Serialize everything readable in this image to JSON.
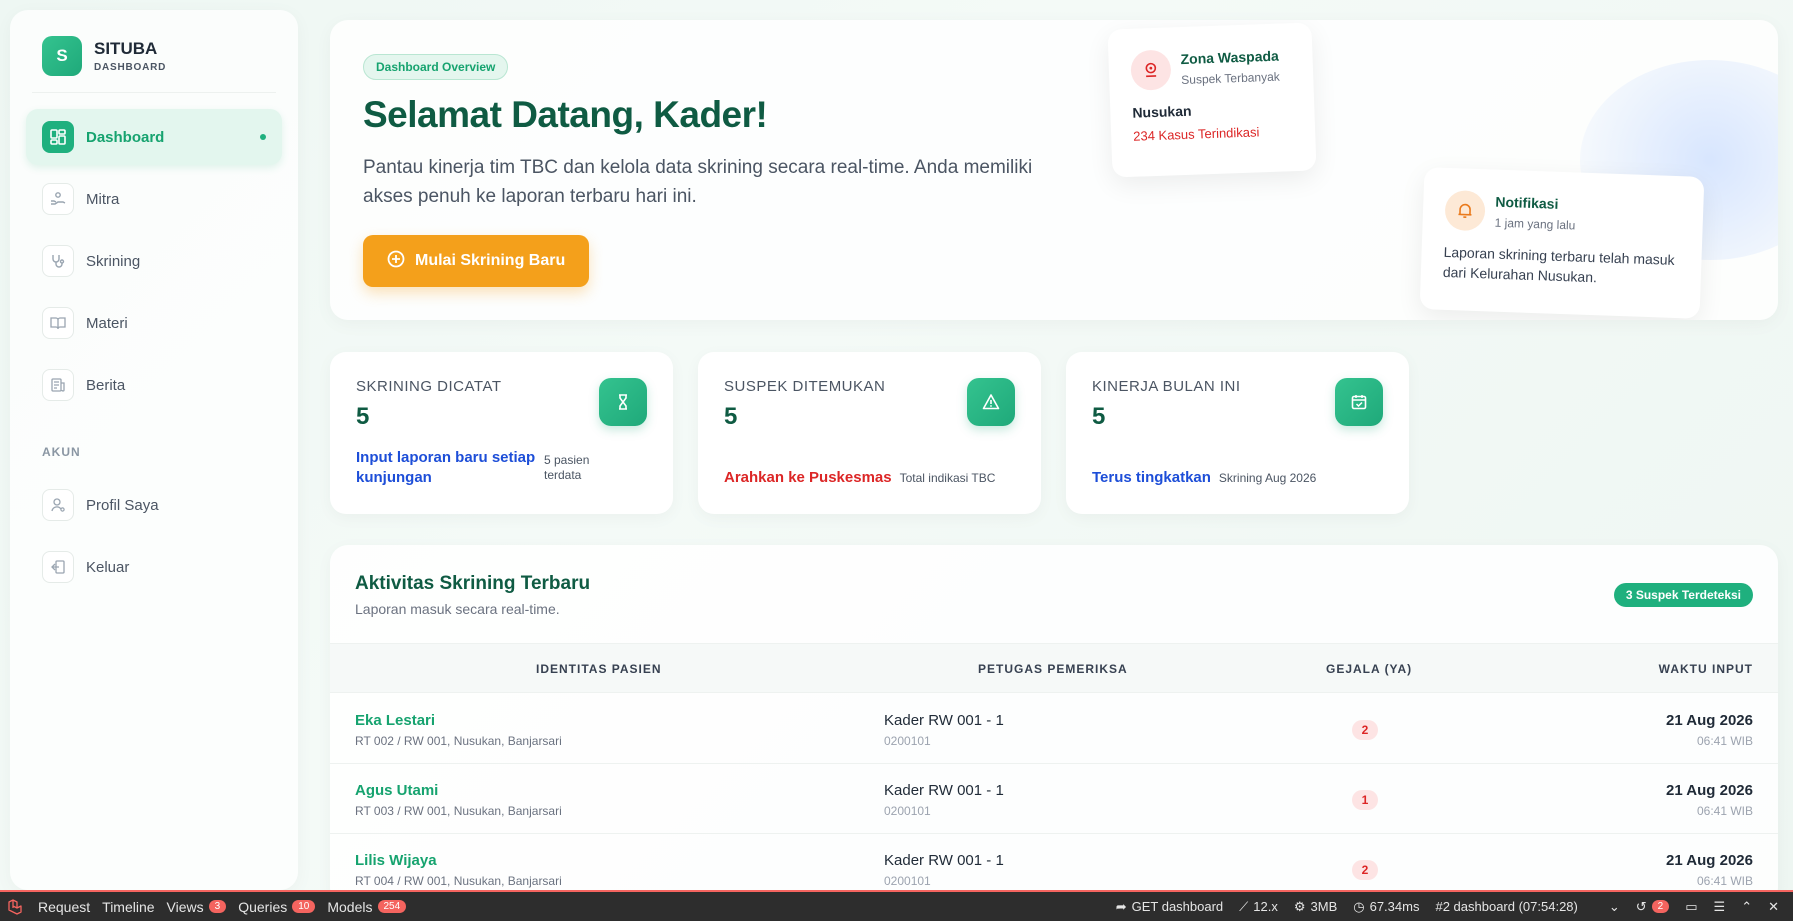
{
  "sidebar": {
    "brand_logo": "S",
    "brand_title": "SITUBA",
    "brand_subtitle": "DASHBOARD",
    "items": [
      {
        "label": "Dashboard",
        "icon": "dashboard-icon",
        "active": true
      },
      {
        "label": "Mitra",
        "icon": "handshake-icon"
      },
      {
        "label": "Skrining",
        "icon": "stethoscope-icon"
      },
      {
        "label": "Materi",
        "icon": "book-icon"
      },
      {
        "label": "Berita",
        "icon": "newspaper-icon"
      }
    ],
    "section_label": "AKUN",
    "account_items": [
      {
        "label": "Profil Saya",
        "icon": "user-icon"
      },
      {
        "label": "Keluar",
        "icon": "logout-icon"
      }
    ]
  },
  "hero": {
    "tag": "Dashboard Overview",
    "title": "Selamat Datang, Kader!",
    "description": "Pantau kinerja tim TBC dan kelola data skrining secara real-time. Anda memiliki akses penuh ke laporan terbaru hari ini.",
    "button_label": "Mulai Skrining Baru",
    "zona": {
      "title": "Zona Waspada",
      "subtitle": "Suspek Terbanyak",
      "place": "Nusukan",
      "count": "234 Kasus Terindikasi"
    },
    "notif": {
      "title": "Notifikasi",
      "time": "1 jam yang lalu",
      "text": "Laporan skrining terbaru telah masuk dari Kelurahan Nusukan."
    }
  },
  "stats": [
    {
      "label": "SKRINING DICATAT",
      "value": "5",
      "link": "Input laporan baru setiap kunjungan",
      "link_color": "#1d4ed8",
      "note": "5 pasien terdata",
      "icon": "hourglass-icon"
    },
    {
      "label": "SUSPEK DITEMUKAN",
      "value": "5",
      "link": "Arahkan ke Puskesmas",
      "link_color": "#dc2626",
      "note": "Total indikasi TBC",
      "icon": "warning-icon"
    },
    {
      "label": "KINERJA BULAN INI",
      "value": "5",
      "link": "Terus tingkatkan",
      "link_color": "#1d4ed8",
      "note": "Skrining Aug 2026",
      "icon": "calendar-check-icon"
    }
  ],
  "activity": {
    "title": "Aktivitas Skrining Terbaru",
    "subtitle": "Laporan masuk secara real-time.",
    "badge": "3 Suspek Terdeteksi",
    "columns": [
      "IDENTITAS PASIEN",
      "PETUGAS PEMERIKSA",
      "GEJALA (YA)",
      "WAKTU INPUT"
    ],
    "rows": [
      {
        "name": "Eka Lestari",
        "address": "RT 002 / RW 001, Nusukan, Banjarsari",
        "officer": "Kader RW 001 - 1",
        "code": "0200101",
        "gejala": "2",
        "date": "21 Aug 2026",
        "time": "06:41 WIB"
      },
      {
        "name": "Agus Utami",
        "address": "RT 003 / RW 001, Nusukan, Banjarsari",
        "officer": "Kader RW 001 - 1",
        "code": "0200101",
        "gejala": "1",
        "date": "21 Aug 2026",
        "time": "06:41 WIB"
      },
      {
        "name": "Lilis Wijaya",
        "address": "RT 004 / RW 001, Nusukan, Banjarsari",
        "officer": "Kader RW 001 - 1",
        "code": "0200101",
        "gejala": "2",
        "date": "21 Aug 2026",
        "time": "06:41 WIB"
      }
    ]
  },
  "debugbar": {
    "tabs": [
      {
        "label": "Request"
      },
      {
        "label": "Timeline"
      },
      {
        "label": "Views",
        "badge": "3"
      },
      {
        "label": "Queries",
        "badge": "10"
      },
      {
        "label": "Models",
        "badge": "254"
      }
    ],
    "route": "GET dashboard",
    "version": "12.x",
    "memory": "3MB",
    "duration": "67.34ms",
    "request": "#2 dashboard (07:54:28)",
    "history_badge": "2"
  }
}
